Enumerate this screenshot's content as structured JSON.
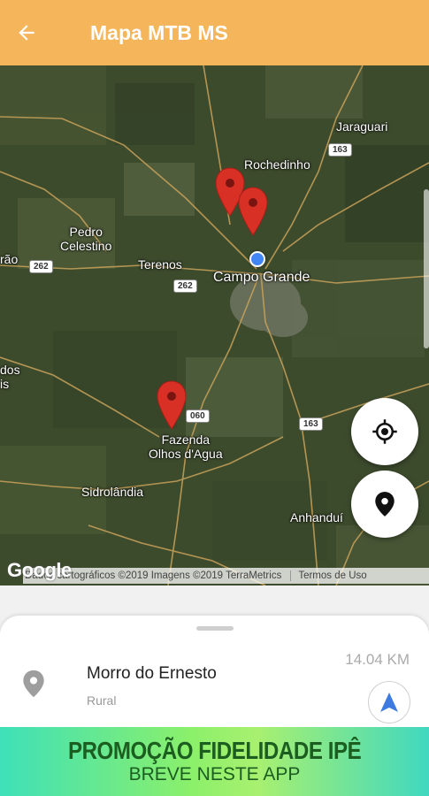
{
  "appbar": {
    "title": "Mapa MTB MS",
    "back_icon": "arrow-left-icon",
    "background": "#f4b55b"
  },
  "map": {
    "places": {
      "jaraguari": "Jaraguari",
      "rochedinho": "Rochedinho",
      "pedro_celestino": "Pedro\nCelestino",
      "terenos": "Terenos",
      "campo_grande": "Campo Grande",
      "fazenda": "Fazenda\nOlhos d'Agua",
      "sidrolandia": "Sidrolândia",
      "anhandui": "Anhanduí",
      "left_edge_1": "rão",
      "left_edge_2": "dos\nis"
    },
    "roads": {
      "br163_top": "163",
      "br262_left": "262",
      "br262_mid": "262",
      "ms060": "060",
      "br163_bottom": "163"
    },
    "markers_count": 3,
    "marker_color": "#d93025",
    "google_logo": "Google",
    "attribution": "Dados cartográficos ©2019 Imagens ©2019 TerraMetrics",
    "terms": "Termos de Uso",
    "fab_my_location_icon": "crosshair-icon",
    "fab_marker_icon": "map-pin-icon"
  },
  "sheet": {
    "place_name": "Morro do Ernesto",
    "place_type": "Rural",
    "distance": "14.04 KM",
    "place_icon": "map-pin-icon",
    "navigate_icon": "navigation-arrow-icon"
  },
  "banner": {
    "title": "PROMOÇÃO FIDELIDADE IPÊ",
    "subtitle": "BREVE NESTE APP"
  }
}
